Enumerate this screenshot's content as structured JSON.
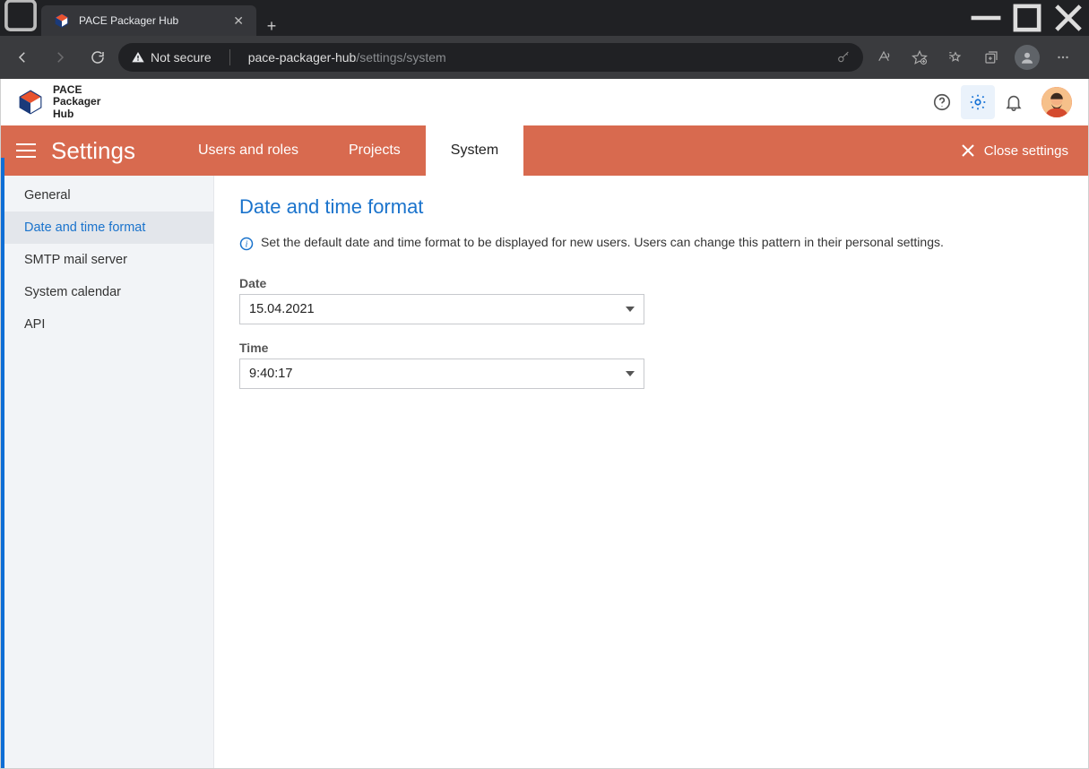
{
  "browser": {
    "tab_title": "PACE Packager Hub",
    "security_label": "Not secure",
    "url_host": "pace-packager-hub",
    "url_path": "/settings/system"
  },
  "app": {
    "logo_line1": "PACE",
    "logo_line2": "Packager",
    "logo_line3": "Hub"
  },
  "settings_bar": {
    "title": "Settings",
    "tabs": [
      "Users and roles",
      "Projects",
      "System"
    ],
    "active_tab": 2,
    "close_label": "Close settings"
  },
  "sidebar": {
    "items": [
      "General",
      "Date and time format",
      "SMTP mail server",
      "System calendar",
      "API"
    ],
    "active": 1
  },
  "page": {
    "title": "Date and time format",
    "info": "Set the default date and time format to be displayed for new users. Users can change this pattern in their personal settings.",
    "date_label": "Date",
    "date_value": "15.04.2021",
    "time_label": "Time",
    "time_value": "9:40:17"
  },
  "colors": {
    "accent": "#d86a4f",
    "link": "#1a73cc"
  }
}
